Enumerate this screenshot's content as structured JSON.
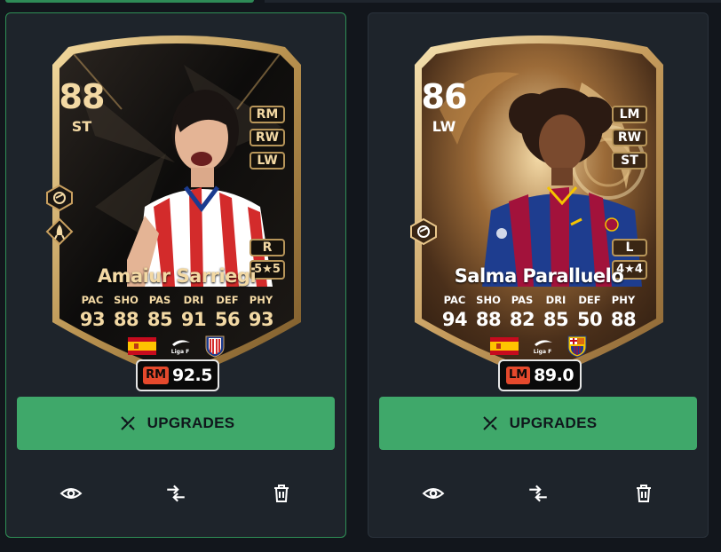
{
  "colors": {
    "panel_bg": "#1e242b",
    "selected_border": "#2f8f56",
    "upgrade_button": "#3fa86a",
    "rating_chip_accent": "#e5492c",
    "card_gold": "#c9a060",
    "card1_text": "#f3d9a4",
    "card2_text": "#ffffff"
  },
  "cards": [
    {
      "rating": "88",
      "position": "ST",
      "alt_positions": [
        "RM",
        "RW",
        "LW"
      ],
      "foot": "R",
      "skill_weak": "5★5",
      "name": "Amaiur Sarriegi",
      "stats": [
        {
          "label": "PAC",
          "value": "93"
        },
        {
          "label": "SHO",
          "value": "88"
        },
        {
          "label": "PAS",
          "value": "85"
        },
        {
          "label": "DRI",
          "value": "91"
        },
        {
          "label": "DEF",
          "value": "56"
        },
        {
          "label": "PHY",
          "value": "93"
        }
      ],
      "nation_icon": "spain-flag",
      "league_icon": "liga-f-logo",
      "league_text": "Liga F",
      "club_icon": "atletico-madrid-crest",
      "chip_position": "RM",
      "chip_rating": "92.5",
      "upgrade_label": "UPGRADES",
      "play_style_icons": [
        "finesse-shot-icon",
        "rocket-icon"
      ]
    },
    {
      "rating": "86",
      "position": "LW",
      "alt_positions": [
        "LM",
        "RW",
        "ST"
      ],
      "foot": "L",
      "skill_weak": "4★4",
      "name": "Salma Paralluelo",
      "stats": [
        {
          "label": "PAC",
          "value": "94"
        },
        {
          "label": "SHO",
          "value": "88"
        },
        {
          "label": "PAS",
          "value": "82"
        },
        {
          "label": "DRI",
          "value": "85"
        },
        {
          "label": "DEF",
          "value": "50"
        },
        {
          "label": "PHY",
          "value": "88"
        }
      ],
      "nation_icon": "spain-flag",
      "league_icon": "liga-f-logo",
      "league_text": "Liga F",
      "club_icon": "fc-barcelona-crest",
      "chip_position": "LM",
      "chip_rating": "89.0",
      "upgrade_label": "UPGRADES",
      "play_style_icons": [
        "finesse-shot-icon"
      ]
    }
  ],
  "actions": [
    "eye-icon",
    "swap-arrows-icon",
    "trash-icon"
  ]
}
